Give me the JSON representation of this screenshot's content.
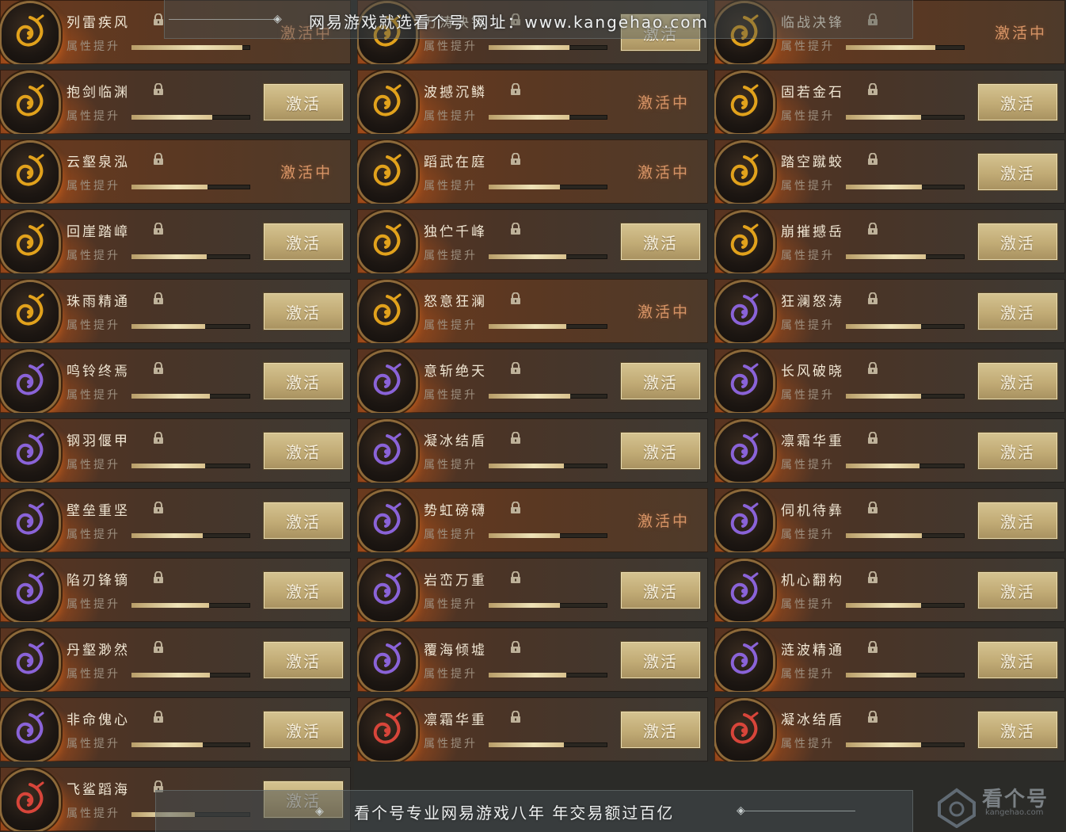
{
  "labels": {
    "sub": "属性提升",
    "activate": "激活",
    "active": "激活中"
  },
  "colors": {
    "gold_button": "#c9b57f",
    "active_text": "#d79466",
    "name_text": "#f1e7d4",
    "fire": "#d65c16",
    "purple_glyph": "#8a63d8",
    "gold_glyph": "#e2a21c",
    "red_glyph": "#d8453a"
  },
  "skills": [
    {
      "name": "列雷疾风",
      "state": "active",
      "progress": 0.93,
      "icon": "gold-rune-icon",
      "color": "gold"
    },
    {
      "name": "万涛决锋",
      "state": "activate",
      "progress": 0.68,
      "icon": "gold-rune-icon",
      "color": "gold"
    },
    {
      "name": "临战决锋",
      "state": "active",
      "progress": 0.75,
      "icon": "gold-rune-icon",
      "color": "gold"
    },
    {
      "name": "抱剑临渊",
      "state": "activate",
      "progress": 0.68,
      "icon": "gold-flame-icon",
      "color": "gold"
    },
    {
      "name": "波撼沉鳞",
      "state": "active",
      "progress": 0.68,
      "icon": "gold-wave-icon",
      "color": "gold"
    },
    {
      "name": "固若金石",
      "state": "activate",
      "progress": 0.63,
      "icon": "gold-swirl-icon",
      "color": "gold"
    },
    {
      "name": "云壑泉泓",
      "state": "active",
      "progress": 0.64,
      "icon": "gold-flame-icon",
      "color": "gold"
    },
    {
      "name": "蹈武在庭",
      "state": "active",
      "progress": 0.6,
      "icon": "gold-swirl-icon",
      "color": "gold"
    },
    {
      "name": "踏空蹴蛟",
      "state": "activate",
      "progress": 0.64,
      "icon": "gold-dragon-icon",
      "color": "gold"
    },
    {
      "name": "回崖踏嶂",
      "state": "activate",
      "progress": 0.63,
      "icon": "gold-swirl-icon",
      "color": "gold"
    },
    {
      "name": "独伫千峰",
      "state": "activate",
      "progress": 0.65,
      "icon": "gold-sun-icon",
      "color": "gold"
    },
    {
      "name": "崩摧撼岳",
      "state": "activate",
      "progress": 0.67,
      "icon": "gold-ring-icon",
      "color": "gold"
    },
    {
      "name": "珠雨精通",
      "state": "activate",
      "progress": 0.62,
      "icon": "gold-drop-icon",
      "color": "gold"
    },
    {
      "name": "怒意狂澜",
      "state": "active",
      "progress": 0.65,
      "icon": "gold-spiral-icon",
      "color": "gold"
    },
    {
      "name": "狂澜怒涛",
      "state": "activate",
      "progress": 0.63,
      "icon": "purple-claw-icon",
      "color": "purple"
    },
    {
      "name": "鸣铃终焉",
      "state": "activate",
      "progress": 0.66,
      "icon": "purple-wind-icon",
      "color": "purple"
    },
    {
      "name": "意斩绝天",
      "state": "activate",
      "progress": 0.69,
      "icon": "purple-claw-icon",
      "color": "purple"
    },
    {
      "name": "长风破晓",
      "state": "activate",
      "progress": 0.63,
      "icon": "purple-claw-icon",
      "color": "purple"
    },
    {
      "name": "钢羽偃甲",
      "state": "activate",
      "progress": 0.62,
      "icon": "purple-wind-icon",
      "color": "purple"
    },
    {
      "name": "凝冰结盾",
      "state": "activate",
      "progress": 0.63,
      "icon": "purple-hook-icon",
      "color": "purple"
    },
    {
      "name": "凛霜华重",
      "state": "activate",
      "progress": 0.62,
      "icon": "purple-star-icon",
      "color": "purple"
    },
    {
      "name": "壁垒重坚",
      "state": "activate",
      "progress": 0.6,
      "icon": "purple-swirl-icon",
      "color": "purple"
    },
    {
      "name": "势虹磅礴",
      "state": "active",
      "progress": 0.6,
      "icon": "purple-spiral-icon",
      "color": "purple"
    },
    {
      "name": "伺机待彝",
      "state": "activate",
      "progress": 0.64,
      "icon": "purple-claw-icon",
      "color": "purple"
    },
    {
      "name": "陷刃锋镝",
      "state": "activate",
      "progress": 0.65,
      "icon": "purple-ring-icon",
      "color": "purple"
    },
    {
      "name": "岩峦万重",
      "state": "activate",
      "progress": 0.6,
      "icon": "purple-ring-icon",
      "color": "purple"
    },
    {
      "name": "机心翻构",
      "state": "activate",
      "progress": 0.63,
      "icon": "purple-star-icon",
      "color": "purple"
    },
    {
      "name": "丹壑渺然",
      "state": "activate",
      "progress": 0.66,
      "icon": "purple-swirl-icon",
      "color": "purple"
    },
    {
      "name": "覆海倾墟",
      "state": "activate",
      "progress": 0.65,
      "icon": "purple-swirl-icon",
      "color": "purple"
    },
    {
      "name": "涟波精通",
      "state": "activate",
      "progress": 0.59,
      "icon": "purple-drop-icon",
      "color": "purple"
    },
    {
      "name": "非命傀心",
      "state": "activate",
      "progress": 0.6,
      "icon": "purple-claw-icon",
      "color": "purple"
    },
    {
      "name": "凛霜华重",
      "state": "activate",
      "progress": 0.63,
      "icon": "red-star-icon",
      "color": "red"
    },
    {
      "name": "凝冰结盾",
      "state": "activate",
      "progress": 0.63,
      "icon": "red-hook-icon",
      "color": "red"
    },
    {
      "name": "飞鲨蹈海",
      "state": "activate",
      "progress": 0.53,
      "icon": "red-dragon-icon",
      "color": "red"
    }
  ],
  "watermark": {
    "top": "网易游戏就选看个号  网址：www.kangehao.com",
    "bottom": "看个号专业网易游戏八年  年交易额过百亿",
    "logo": "看个号",
    "logo_url": "kangehao.com"
  }
}
